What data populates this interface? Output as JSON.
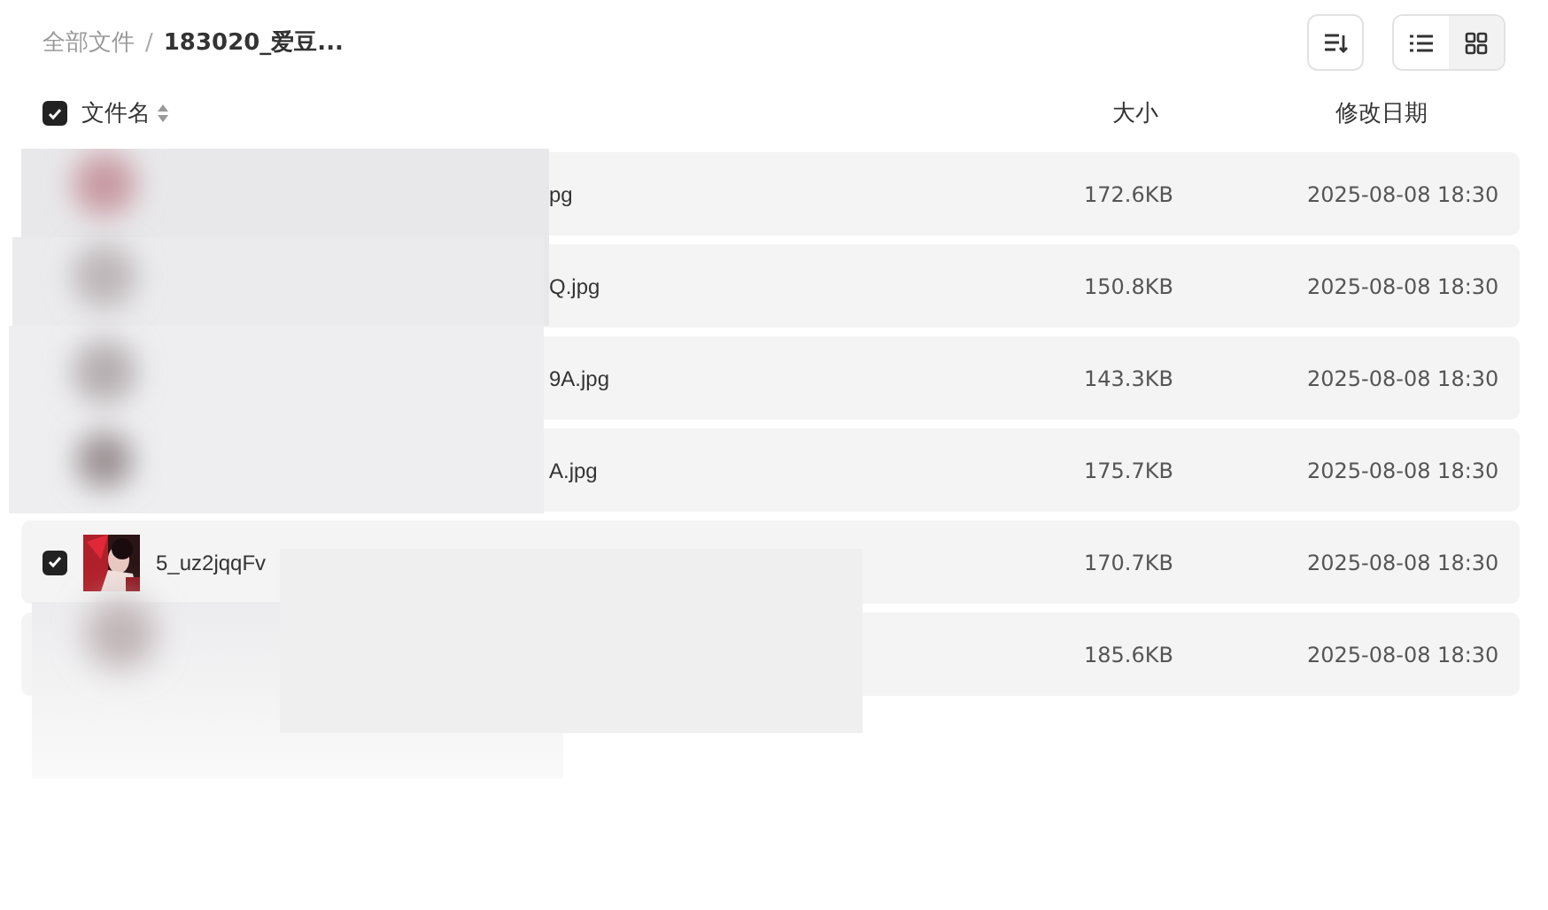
{
  "breadcrumb": [
    {
      "label": "全部文件"
    },
    {
      "label": "183020_爱豆..."
    }
  ],
  "breadcrumb_separator": "/",
  "view_modes": [
    {
      "kind": "list",
      "selected": true
    },
    {
      "kind": "grid",
      "selected": false
    }
  ],
  "table": {
    "select_all": {
      "checked": true
    },
    "columns": [
      "文件名",
      "大小",
      "修改日期"
    ],
    "rows": [
      {
        "name": "pg",
        "size": "172.6KB",
        "date": "2025-08-08 18:30"
      },
      {
        "name": "Q.jpg",
        "size": "150.8KB",
        "date": "2025-08-08 18:30"
      },
      {
        "name": "9A.jpg",
        "size": "143.3KB",
        "date": "2025-08-08 18:30"
      },
      {
        "name": "A.jpg",
        "size": "175.7KB",
        "date": "2025-08-08 18:30"
      },
      {
        "name": "5_uz2jqqFv",
        "size": "170.7KB",
        "date": "2025-08-08 18:30",
        "checked": true
      },
      {
        "size": "185.6KB",
        "date": "2025-08-08 18:30"
      }
    ]
  }
}
